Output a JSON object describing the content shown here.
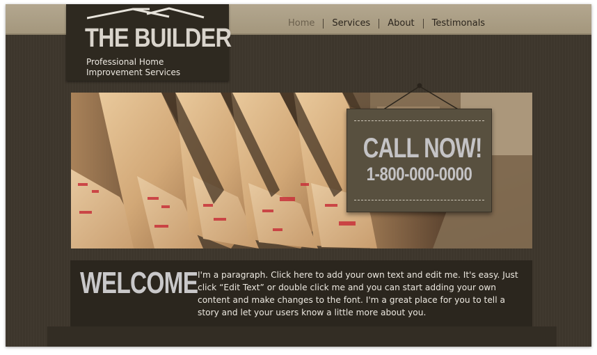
{
  "nav": {
    "items": [
      {
        "label": "Home"
      },
      {
        "label": "Services"
      },
      {
        "label": "About"
      },
      {
        "label": "Testimonals"
      }
    ]
  },
  "logo": {
    "title": "THE BUILDER",
    "subtitle": "Professional Home Improvement Services"
  },
  "call": {
    "heading": "CALL NOW!",
    "phone": "1-800-000-0000"
  },
  "welcome": {
    "title": "WELCOME",
    "text": "I'm a paragraph. Click here to add your own text and edit me. It's easy. Just click “Edit Text” or double click me and you can start adding your own content and make changes to the font. I'm a great place for you to tell a story and let your users know a little more about you."
  },
  "colors": {
    "background": "#3d362c",
    "topbar": "#a99c82",
    "logo_box": "#2e2920",
    "callbox": "#58503f",
    "welcome_box": "#2b261e"
  }
}
